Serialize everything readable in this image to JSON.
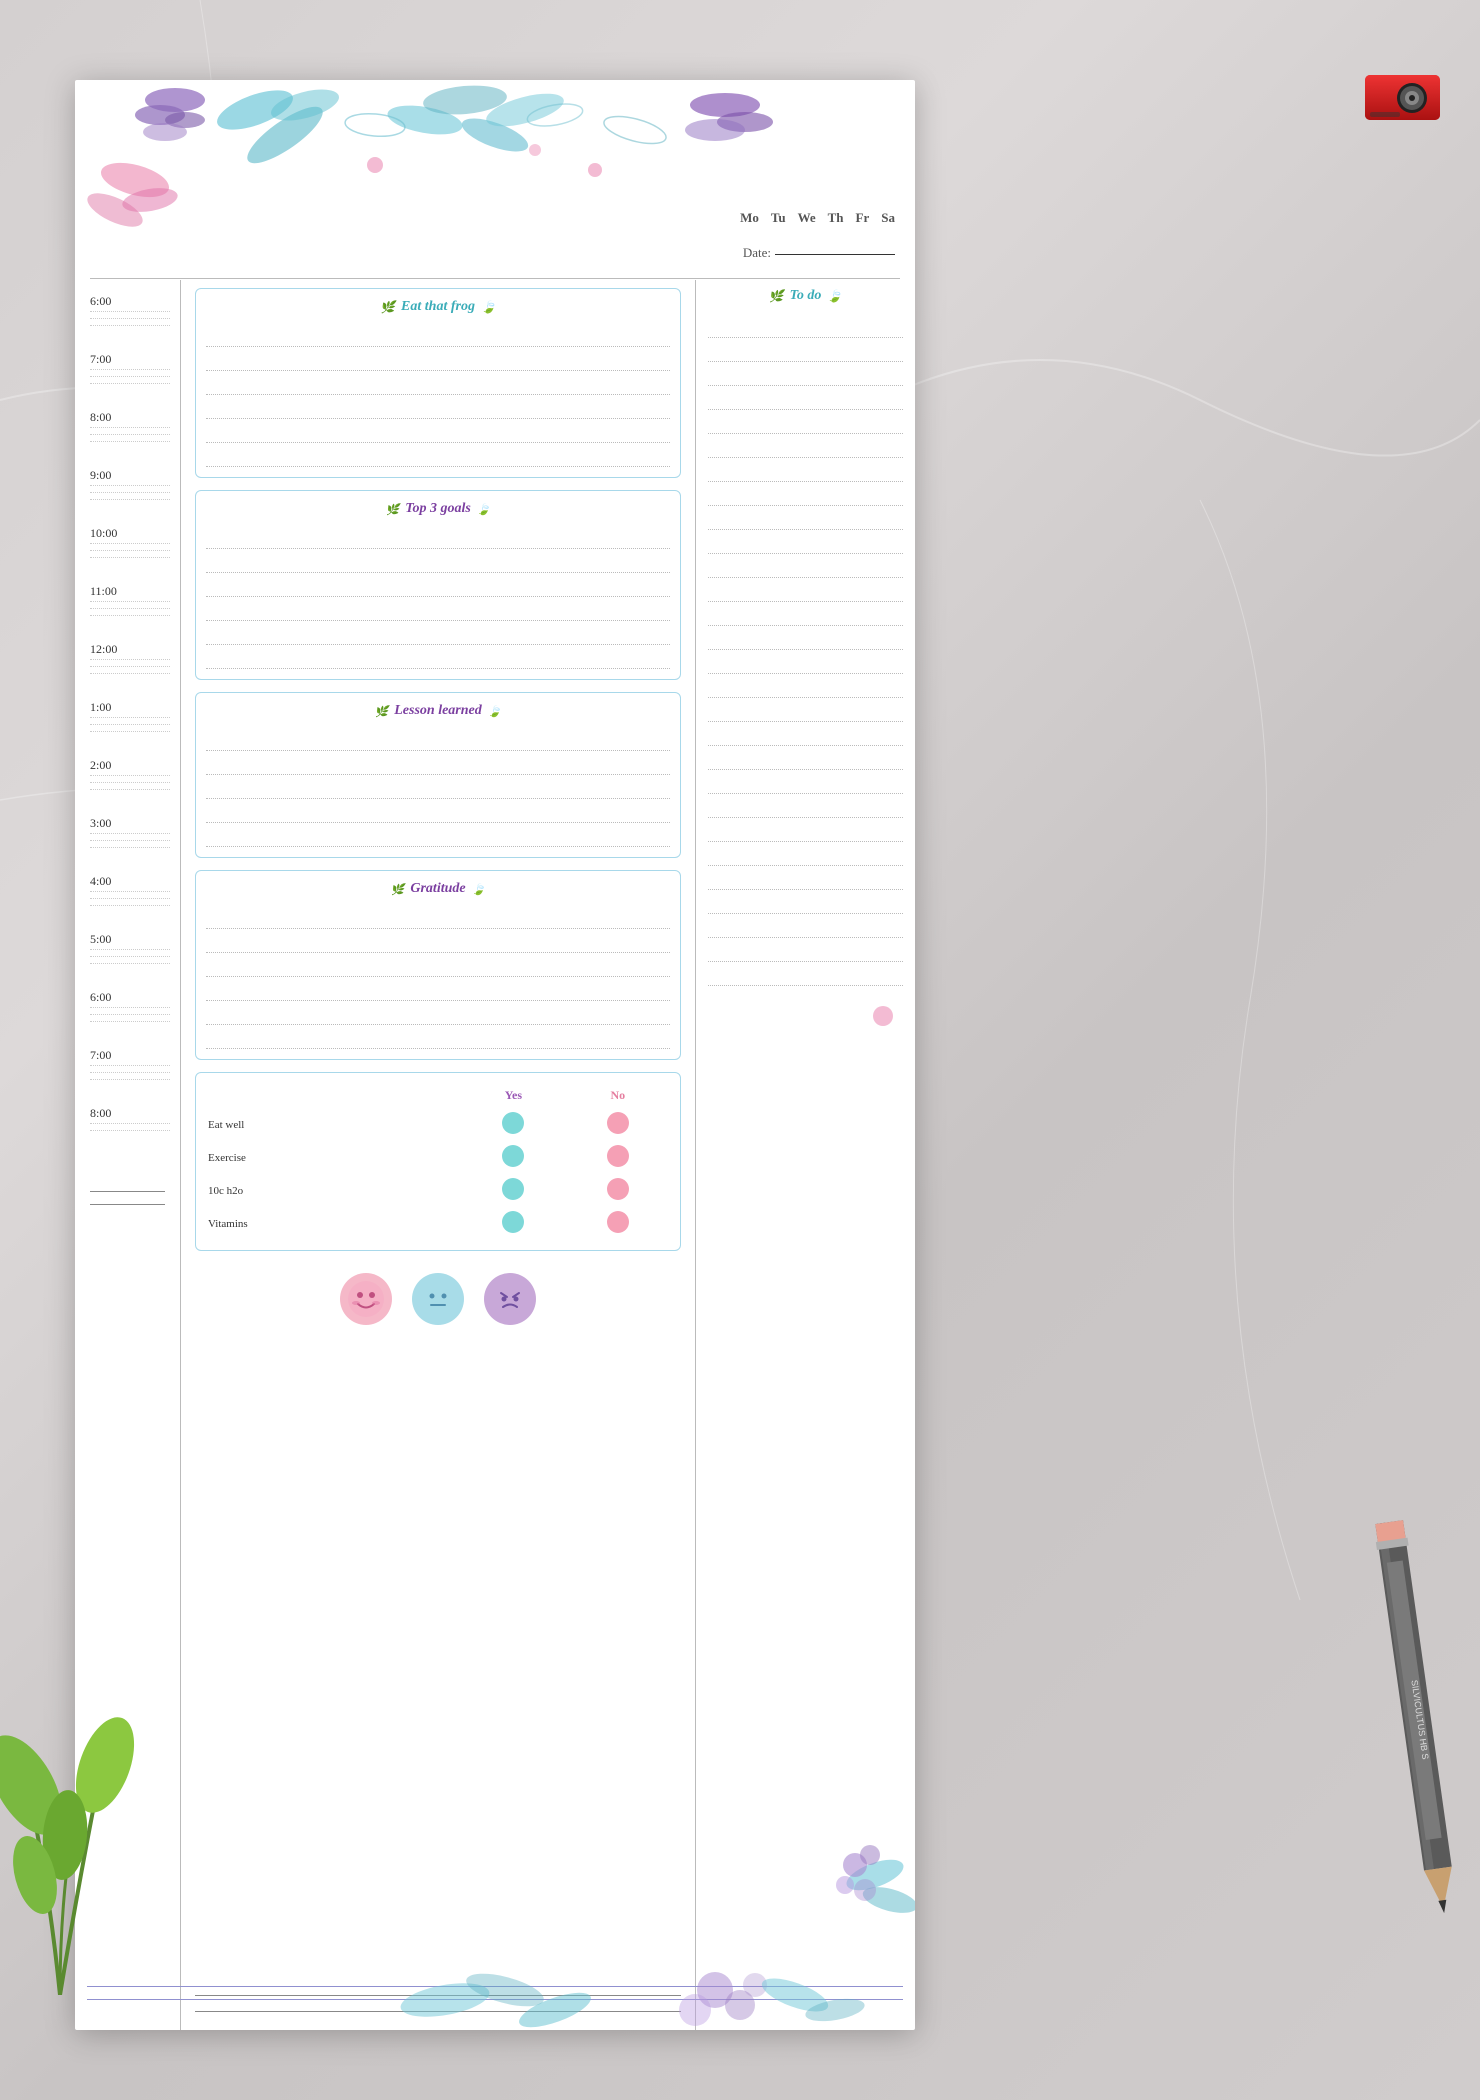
{
  "page": {
    "days": [
      "Mo",
      "Tu",
      "We",
      "Th",
      "Fr",
      "Sa"
    ],
    "date_label": "Date:",
    "sections": {
      "eat_that_frog": {
        "title": "Eat that frog",
        "lines": 6
      },
      "top_3_goals": {
        "title": "Top 3 goals",
        "lines": 6
      },
      "lesson_learned": {
        "title": "Lesson learned",
        "lines": 5
      },
      "gratitude": {
        "title": "Gratitude",
        "lines": 6
      },
      "to_do": {
        "title": "To do",
        "lines": 28
      }
    },
    "habit_tracker": {
      "yes_label": "Yes",
      "no_label": "No",
      "habits": [
        "Eat well",
        "Exercise",
        "10c h2o",
        "Vitamins"
      ]
    },
    "moods": [
      "😊",
      "😐",
      "😠"
    ],
    "time_slots": [
      "6:00",
      "7:00",
      "8:00",
      "9:00",
      "10:00",
      "11:00",
      "12:00",
      "1:00",
      "2:00",
      "3:00",
      "4:00",
      "5:00",
      "6:00",
      "7:00",
      "8:00"
    ]
  }
}
